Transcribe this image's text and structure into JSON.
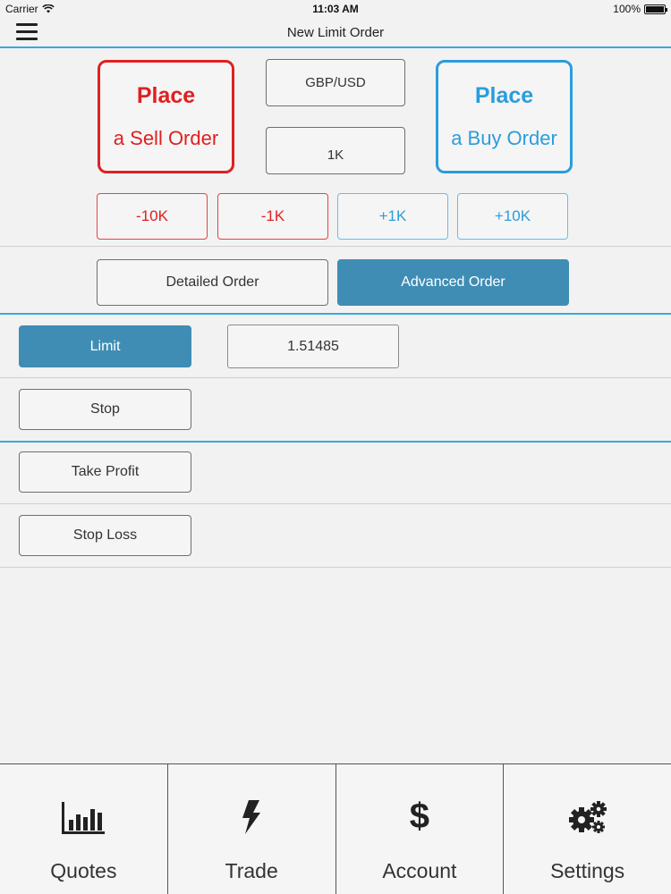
{
  "status_bar": {
    "carrier": "Carrier",
    "time": "11:03 AM",
    "battery": "100%"
  },
  "nav": {
    "title": "New Limit Order"
  },
  "order": {
    "sell": {
      "line1": "Place",
      "line2": "a Sell Order"
    },
    "buy": {
      "line1": "Place",
      "line2": "a Buy Order"
    },
    "instrument": "GBP/USD",
    "amount": "1K",
    "adjust": {
      "minus10k": "-10K",
      "minus1k": "-1K",
      "plus1k": "+1K",
      "plus10k": "+10K"
    },
    "detailed_label": "Detailed Order",
    "advanced_label": "Advanced Order"
  },
  "rows": {
    "limit_label": "Limit",
    "limit_value": "1.51485",
    "stop_label": "Stop",
    "take_profit_label": "Take Profit",
    "stop_loss_label": "Stop Loss"
  },
  "tabs": [
    {
      "label": "Quotes",
      "icon": "bar-chart-icon"
    },
    {
      "label": "Trade",
      "icon": "lightning-icon"
    },
    {
      "label": "Account",
      "icon": "dollar-icon"
    },
    {
      "label": "Settings",
      "icon": "gears-icon"
    }
  ],
  "colors": {
    "sell": "#e02020",
    "buy": "#2a9ddc",
    "selected": "#3f8db5",
    "separator": "#3aa9da"
  }
}
